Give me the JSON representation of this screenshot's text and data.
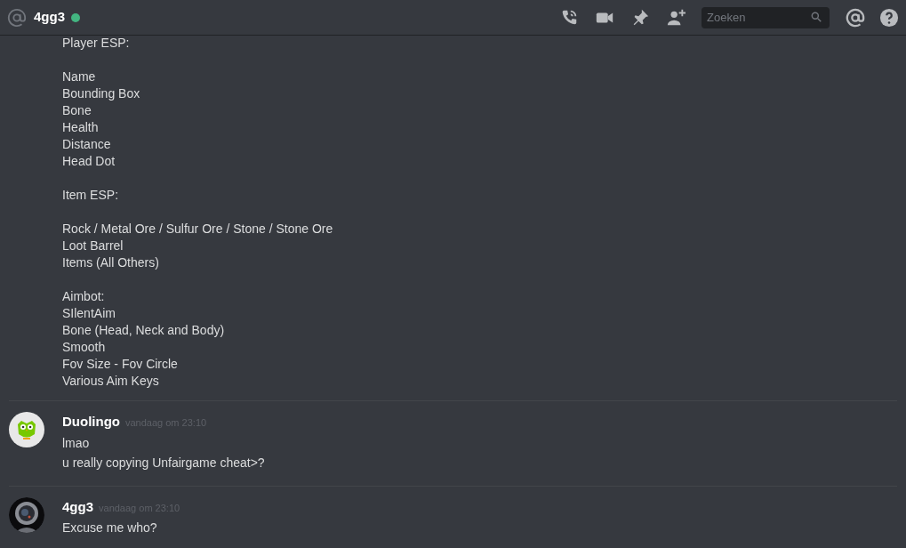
{
  "header": {
    "channel": "4gg3",
    "online": true,
    "search": {
      "placeholder": "Zoeken"
    }
  },
  "messages": [
    {
      "kind": "continuation",
      "blocks": [
        [
          "Player ESP:"
        ],
        [
          "Name",
          "Bounding Box",
          "Bone",
          "Health",
          "Distance",
          "Head Dot"
        ],
        [
          "Item ESP:"
        ],
        [
          "Rock / Metal Ore / Sulfur Ore / Stone / Stone Ore",
          "Loot Barrel",
          "Items (All Others)"
        ],
        [
          "Aimbot:",
          "SIlentAim",
          "Bone (Head, Neck and Body)",
          "Smooth",
          "Fov Size - Fov Circle",
          "Various Aim Keys"
        ]
      ]
    },
    {
      "kind": "message",
      "author": "Duolingo",
      "avatar": {
        "kind": "bird"
      },
      "time": "vandaag om 23:10",
      "lines": [
        "lmao",
        "u really copying Unfairgame cheat>?"
      ]
    },
    {
      "kind": "message",
      "author": "4gg3",
      "avatar": {
        "kind": "picture"
      },
      "time": "vandaag om 23:10",
      "lines": [
        "Excuse me who?"
      ]
    }
  ]
}
